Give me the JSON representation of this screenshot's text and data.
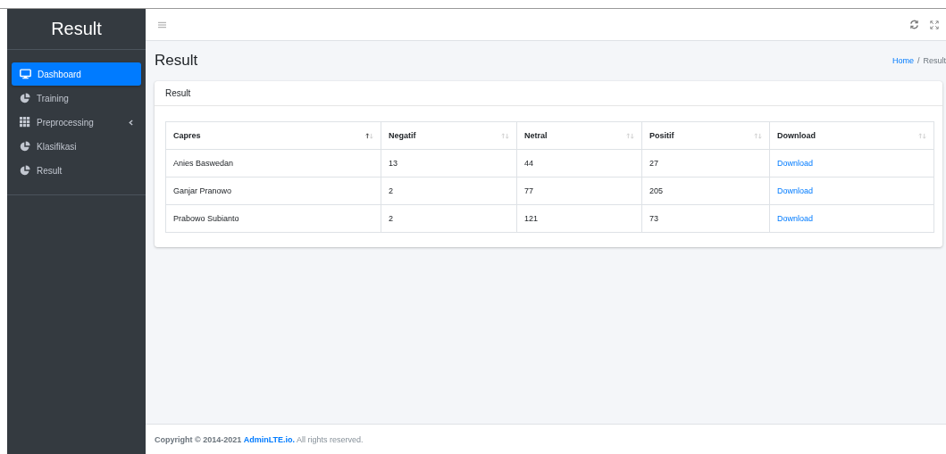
{
  "sidebar": {
    "brand": "Result",
    "items": [
      {
        "label": "Dashboard",
        "selected": true,
        "has_submenu": false
      },
      {
        "label": "Training",
        "selected": false,
        "has_submenu": false
      },
      {
        "label": "Preprocessing",
        "selected": false,
        "has_submenu": true
      },
      {
        "label": "Klasifikasi",
        "selected": false,
        "has_submenu": false
      },
      {
        "label": "Result",
        "selected": false,
        "has_submenu": false
      }
    ]
  },
  "page": {
    "title": "Result",
    "breadcrumb": [
      {
        "label": "Home",
        "kind": "link"
      },
      {
        "label": "/",
        "kind": "separator"
      },
      {
        "label": "Result",
        "kind": "current"
      }
    ]
  },
  "card": {
    "title": "Result",
    "table": {
      "columns": [
        {
          "label": "Capres",
          "sorted": true
        },
        {
          "label": "Negatif",
          "sorted": false
        },
        {
          "label": "Netral",
          "sorted": false
        },
        {
          "label": "Positif",
          "sorted": false
        },
        {
          "label": "Download",
          "sorted": false
        }
      ],
      "rows": [
        {
          "cells": [
            "Anies Baswedan",
            "13",
            "44",
            "27",
            "Download"
          ]
        },
        {
          "cells": [
            "Ganjar Pranowo",
            "2",
            "77",
            "205",
            "Download"
          ]
        },
        {
          "cells": [
            "Prabowo Subianto",
            "2",
            "121",
            "73",
            "Download"
          ]
        }
      ]
    }
  },
  "footer": {
    "copyright": "Copyright © 2014-2021",
    "link": "AdminLTE.io.",
    "suffix": "All rights reserved."
  }
}
